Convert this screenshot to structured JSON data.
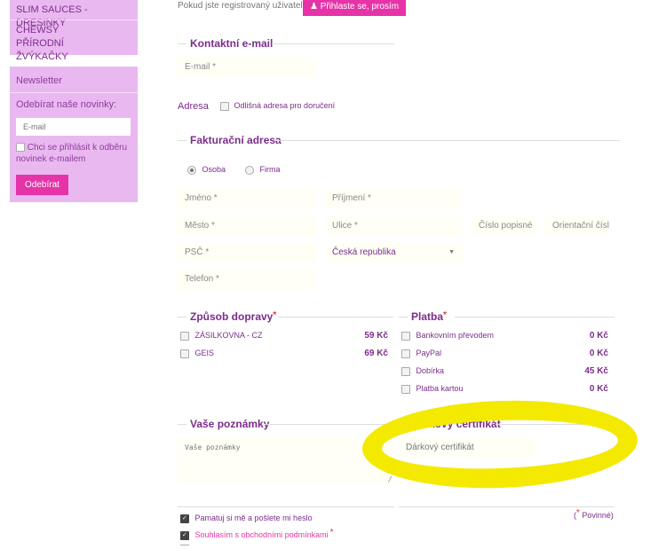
{
  "sidebar": {
    "links": [
      "SLIM SAUCES - DRESINKY",
      "CHEWSY PŘÍRODNÍ ŽVÝKAČKY"
    ],
    "newsletter": {
      "title": "Newsletter",
      "subscribe_label": "Odebírat naše novinky:",
      "email_placeholder": "E-mail",
      "consent_label": "Chci se přihlásit k odběru novinek e-mailem",
      "button": "Odebírat"
    }
  },
  "login": {
    "prompt": "Pokud jste registrovaný uživatel,",
    "button": "Přihlaste se, prosím"
  },
  "contact": {
    "legend": "Kontaktní e-mail",
    "email_placeholder": "E-mail *"
  },
  "address": {
    "label": "Adresa",
    "different_delivery": "Odlišná adresa pro doručení"
  },
  "billing": {
    "legend": "Fakturační adresa",
    "radio_person": "Osoba",
    "radio_company": "Firma",
    "first_name": "Jméno *",
    "last_name": "Příjmení *",
    "city": "Město *",
    "street": "Ulice *",
    "house_number": "Číslo popisné",
    "orientation_number": "Orientační číslo",
    "zip": "PSČ *",
    "country": "Česká republika",
    "phone": "Telefon *"
  },
  "shipping": {
    "legend": "Způsob dopravy",
    "required_mark": "*",
    "options": [
      {
        "label": "ZÁSILKOVNA - CZ",
        "price": "59 Kč"
      },
      {
        "label": "GEIS",
        "price": "69 Kč"
      }
    ]
  },
  "payment": {
    "legend": "Platba",
    "required_mark": "*",
    "options": [
      {
        "label": "Bankovním převodem",
        "price": "0 Kč"
      },
      {
        "label": "PayPal",
        "price": "0 Kč"
      },
      {
        "label": "Dobírka",
        "price": "45 Kč"
      },
      {
        "label": "Platba kartou",
        "price": "0 Kč"
      }
    ]
  },
  "notes": {
    "legend": "Vaše poznámky",
    "placeholder": "Vaše poznámky"
  },
  "gift": {
    "legend": "Dárkový certifikát",
    "placeholder": "Dárkový certifikát"
  },
  "required_note": {
    "mark": "*",
    "text": " Povinné)",
    "open": "("
  },
  "consents": {
    "remember": "Pamatuj si mě a pošlete mi heslo",
    "terms": "Souhlasím s obchodními podmínkami",
    "terms_mark": "*"
  },
  "colors": {
    "sidebar_bg": "#e9b8f0",
    "accent_pink": "#e633a8",
    "title_purple": "#7b2d8a",
    "highlight_yellow": "#f4e900"
  }
}
